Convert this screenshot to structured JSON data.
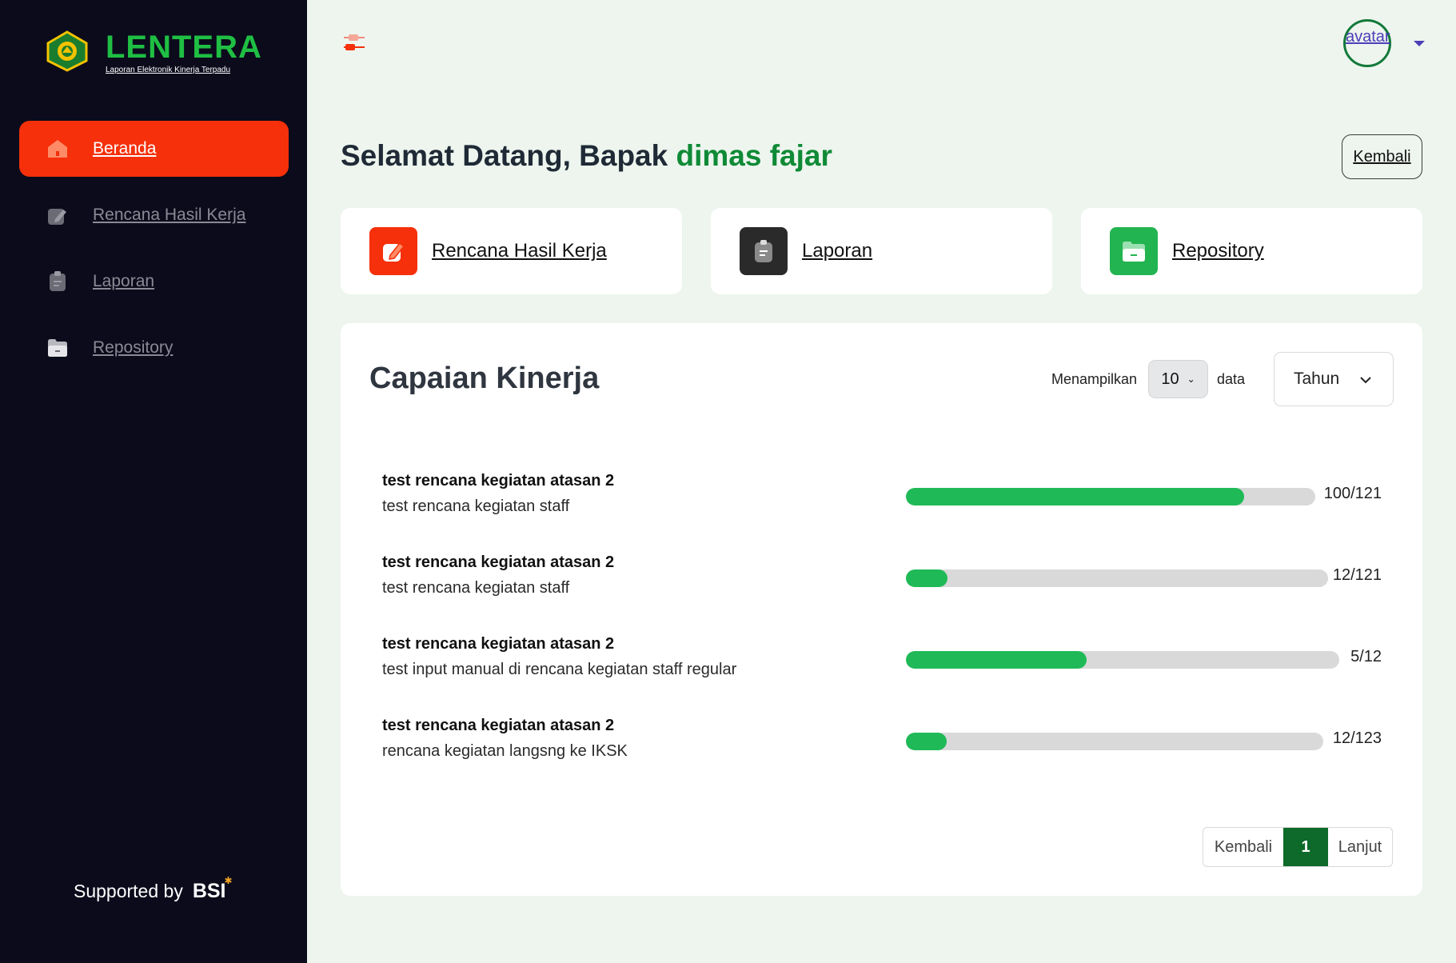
{
  "brand": {
    "name": "LENTERA",
    "subtitle": "Laporan Elektronik Kinerja Terpadu"
  },
  "sidebar": {
    "items": [
      {
        "label": "Beranda",
        "icon": "home-icon",
        "active": true
      },
      {
        "label": "Rencana Hasil Kerja",
        "icon": "edit-note-icon",
        "active": false
      },
      {
        "label": "Laporan",
        "icon": "clipboard-icon",
        "active": false
      },
      {
        "label": "Repository",
        "icon": "folder-icon",
        "active": false
      }
    ],
    "supported_by": "Supported by",
    "sponsor": "BSI"
  },
  "header": {
    "avatar_alt": "avatar",
    "greeting": "Selamat Datang, Bapak",
    "user_name": "dimas fajar",
    "back_label": "Kembali"
  },
  "quick_cards": [
    {
      "label": "Rencana Hasil Kerja",
      "icon": "edit-note-icon",
      "color": "#f5300a"
    },
    {
      "label": "Laporan",
      "icon": "clipboard-icon",
      "color": "#2a2a2a"
    },
    {
      "label": "Repository",
      "icon": "folder-icon",
      "color": "#22b450"
    }
  ],
  "performance": {
    "title": "Capaian Kinerja",
    "show_label": "Menampilkan",
    "page_size": "10",
    "data_label": "data",
    "year_filter": "Tahun",
    "rows": [
      {
        "title": "test rencana kegiatan atasan 2",
        "subtitle": "test rencana kegiatan staff",
        "value": "100/121",
        "progress": 0.826
      },
      {
        "title": "test rencana kegiatan atasan 2",
        "subtitle": "test rencana kegiatan staff",
        "value": "12/121",
        "progress": 0.099
      },
      {
        "title": "test rencana kegiatan atasan 2",
        "subtitle": "test input manual di rencana kegiatan staff regular",
        "value": "5/12",
        "progress": 0.417
      },
      {
        "title": "test rencana kegiatan atasan 2",
        "subtitle": "rencana kegiatan langsng ke IKSK",
        "value": "12/123",
        "progress": 0.098
      }
    ],
    "pagination": {
      "prev": "Kembali",
      "current": "1",
      "next": "Lanjut"
    }
  },
  "colors": {
    "accent": "#f5300a",
    "brand_green": "#1fbf43",
    "progress_fill": "#1fba57",
    "page_active": "#0d6a2a"
  }
}
